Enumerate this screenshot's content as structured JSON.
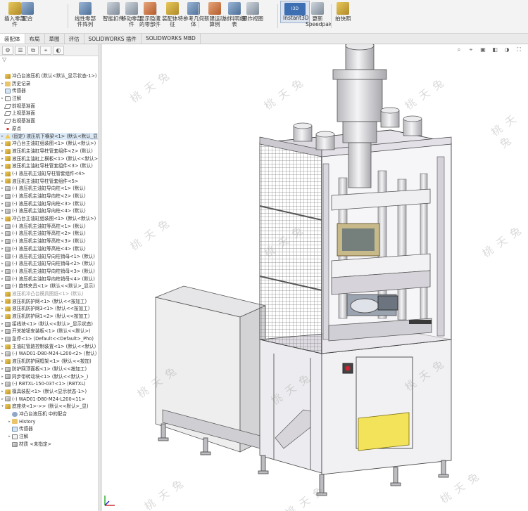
{
  "ribbon": {
    "buttons": [
      {
        "label": "插入零部件",
        "icon": "insert-component-icon"
      },
      {
        "label": "配合",
        "icon": "mate-icon"
      },
      {
        "label": "线性零部件阵列",
        "icon": "linear-pattern-icon"
      },
      {
        "label": "智能扣件",
        "icon": "smart-fastener-icon"
      },
      {
        "label": "移动零部件",
        "icon": "move-component-icon"
      },
      {
        "label": "显示隐藏的零部件",
        "icon": "show-hidden-icon"
      },
      {
        "label": "装配体特征",
        "icon": "assembly-feature-icon"
      },
      {
        "label": "参考几何体",
        "icon": "reference-geometry-icon"
      },
      {
        "label": "新建运动算例",
        "icon": "motion-study-icon"
      },
      {
        "label": "材料明细表",
        "icon": "bom-icon"
      },
      {
        "label": "爆炸视图",
        "icon": "exploded-view-icon"
      },
      {
        "label": "Instant3D",
        "icon": "instant3d-icon"
      },
      {
        "label": "更新Speedpak",
        "icon": "speedpak-icon"
      },
      {
        "label": "拍快照",
        "icon": "snapshot-icon"
      }
    ]
  },
  "tabs": [
    "装配体",
    "布局",
    "草图",
    "评估",
    "SOLIDWORKS 插件",
    "SOLIDWORKS MBD"
  ],
  "panel": {
    "toolbar": [
      "⚙",
      "☰",
      "⧉",
      "⌖",
      "◐"
    ],
    "filter": "▽",
    "tree": [
      {
        "label": "冲凸台液压机 (默认<默认_显示状态-1>)",
        "icon": "asm",
        "exp": ""
      },
      {
        "label": "历史记录",
        "icon": "fold",
        "exp": "▸"
      },
      {
        "label": "传感器",
        "icon": "sens",
        "exp": ""
      },
      {
        "label": "注解",
        "icon": "note",
        "exp": "▸"
      },
      {
        "label": "前视基准面",
        "icon": "plane",
        "exp": ""
      },
      {
        "label": "上视基准面",
        "icon": "plane",
        "exp": ""
      },
      {
        "label": "右视基准面",
        "icon": "plane",
        "exp": ""
      },
      {
        "label": "原点",
        "icon": "origin",
        "exp": ""
      },
      {
        "label": "(固定) 液压机下横梁<1> (默认<默认_显示状态>)",
        "icon": "warn",
        "exp": "▸",
        "hl": true
      },
      {
        "label": "冲凸台主油缸组装图<1> (默认<默认>)",
        "icon": "asm",
        "exp": "▸"
      },
      {
        "label": "液压机主油缸导柱管套组件<2> (默认)",
        "icon": "asm",
        "exp": "▸"
      },
      {
        "label": "液压机主油缸上横板<1> (默认<<默认>)",
        "icon": "asm",
        "exp": "▸"
      },
      {
        "label": "液压机主油缸导柱管套组件<3> (默认)",
        "icon": "asm",
        "exp": "▸"
      },
      {
        "label": "(-) 液压机主油缸导柱管套组件<4>",
        "icon": "asm",
        "exp": "▸"
      },
      {
        "label": "液压机主油缸导柱管套组件<5>",
        "icon": "asm",
        "exp": "▸"
      },
      {
        "label": "(-) 液压机主油缸导向柱<1> (默认)",
        "icon": "part",
        "exp": "▸"
      },
      {
        "label": "(-) 液压机主油缸导向柱<2> (默认)",
        "icon": "part",
        "exp": "▸"
      },
      {
        "label": "(-) 液压机主油缸导向柱<3> (默认)",
        "icon": "part",
        "exp": "▸"
      },
      {
        "label": "(-) 液压机主油缸导向柱<4> (默认)",
        "icon": "part",
        "exp": "▸"
      },
      {
        "label": "冲凸台主油缸组装图<1> (默认<默认>)",
        "icon": "asm",
        "exp": "▸"
      },
      {
        "label": "(-) 液压机主油缸等高柱<1> (默认)",
        "icon": "part",
        "exp": "▸"
      },
      {
        "label": "(-) 液压机主油缸等高柱<2> (默认)",
        "icon": "part",
        "exp": "▸"
      },
      {
        "label": "(-) 液压机主油缸等高柱<3> (默认)",
        "icon": "part",
        "exp": "▸"
      },
      {
        "label": "(-) 液压机主油缸等高柱<4> (默认)",
        "icon": "part",
        "exp": "▸"
      },
      {
        "label": "(-) 液压机主油缸导向柱销母<1> (默认)",
        "icon": "part",
        "exp": "▸"
      },
      {
        "label": "(-) 液压机主油缸导向柱销母<2> (默认)",
        "icon": "part",
        "exp": "▸"
      },
      {
        "label": "(-) 液压机主油缸导向柱销母<3> (默认)",
        "icon": "part",
        "exp": "▸"
      },
      {
        "label": "(-) 液压机主油缸导向柱销母<4> (默认)",
        "icon": "part",
        "exp": "▸"
      },
      {
        "label": "(-) 旋转夹具<1> (默认<<默认>_显示)",
        "icon": "part",
        "exp": "▸"
      },
      {
        "label": "液压机冲凸台模具图纸<1> (默认)",
        "icon": "asm",
        "exp": "",
        "grey": true
      },
      {
        "label": "液压机防护网<1> (默认<<按加工)",
        "icon": "asm",
        "exp": "▸"
      },
      {
        "label": "液压机防护网3<1> (默认<<按加工)",
        "icon": "asm",
        "exp": "▸"
      },
      {
        "label": "液压机防护网1<2> (默认<<按加工)",
        "icon": "asm",
        "exp": "▸"
      },
      {
        "label": "接线块<1> (默认<<默认>_显示状态)",
        "icon": "part",
        "exp": "▸"
      },
      {
        "label": "开关按钮安装板<1> (默认<<默认>)",
        "icon": "part",
        "exp": "▸"
      },
      {
        "label": "急停<1> (Default<<Default>_Pho)",
        "icon": "part",
        "exp": "▸"
      },
      {
        "label": "主油缸管路控制装置<1> (默认<<默认)",
        "icon": "asm",
        "exp": "▸"
      },
      {
        "label": "(-) WAD01-D80-M24-L200<2> (默认)",
        "icon": "part",
        "exp": "▸"
      },
      {
        "label": "液压机防护网框架<1> (默认<<按加)",
        "icon": "asm",
        "exp": "▸"
      },
      {
        "label": "防护网顶面板<1> (默认<<按加工)",
        "icon": "part",
        "exp": "▸"
      },
      {
        "label": "同步带转动块<1> (默认<<默认>_)",
        "icon": "part",
        "exp": "▸"
      },
      {
        "label": "(-) RBTXL-150-037<1> (RBTXL)",
        "icon": "part",
        "exp": "▸"
      },
      {
        "label": "模具装配<1> (默认<显示状态-1>)",
        "icon": "asm",
        "exp": "▸"
      },
      {
        "label": "(-) WAD01-D80-M24-L200<11>",
        "icon": "part",
        "exp": "▸"
      },
      {
        "label": "底座块<1>->> (默认<<默认>_显)",
        "icon": "asm",
        "exp": "▾"
      },
      {
        "label": "冲凸台液压机 中的配合",
        "icon": "mate",
        "exp": ""
      },
      {
        "label": "History",
        "icon": "fold",
        "exp": "▸"
      },
      {
        "label": "传感器",
        "icon": "sens",
        "exp": ""
      },
      {
        "label": "注解",
        "icon": "note",
        "exp": "▸"
      },
      {
        "label": "材质 <未指定>",
        "icon": "part",
        "exp": ""
      }
    ]
  },
  "graphics": {
    "view_tools": [
      "⌕",
      "⌖",
      "▣",
      "◧",
      "◑",
      "⛶"
    ],
    "watermark": "桃 夭 兔"
  },
  "colors": {
    "frame": "#e2dfe6",
    "frame_dark": "#b8b4bd",
    "cylinder": "#d9d9dc",
    "mesh": "#8a8a8a",
    "accent_yellow": "#f3e35a",
    "accent_blue": "#3d6fb2"
  }
}
